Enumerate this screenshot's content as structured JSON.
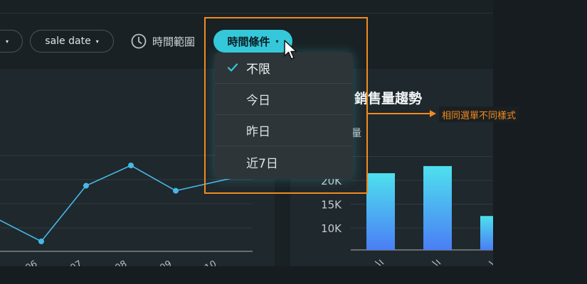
{
  "filters": {
    "partial_chip_caret": "▾",
    "sale_date_label": "sale date",
    "sale_date_caret": "▾",
    "time_range_label": "時間範圍",
    "time_condition_label": "時間條件",
    "time_condition_caret": "▾"
  },
  "dropdown": {
    "items": [
      {
        "label": "不限",
        "selected": true
      },
      {
        "label": "今日",
        "selected": false
      },
      {
        "label": "昨日",
        "selected": false
      },
      {
        "label": "近7日",
        "selected": false
      }
    ]
  },
  "annotation": {
    "label": "相同選單不同樣式",
    "color": "#f28a1e"
  },
  "colors": {
    "accent": "#35c8da",
    "line_series": "#46b8e8",
    "bar_top": "#4ee0ee",
    "bar_bottom": "#4a7ef5"
  },
  "icons": {
    "clock": "clock-icon",
    "check": "check-icon",
    "cursor": "mouse-pointer-icon"
  },
  "chart_data": [
    {
      "type": "line",
      "categories": [
        "06",
        "07",
        "08",
        "09",
        "10"
      ],
      "values": [
        null,
        1.0,
        3.2,
        4.0,
        3.0
      ],
      "tick_labels": [
        "06",
        "07",
        "08",
        "09",
        "10"
      ],
      "title": "",
      "grid": true
    },
    {
      "type": "bar",
      "title": "銷售量趨勢",
      "ylabel": "量",
      "y_ticks": [
        "10K",
        "15K",
        "20K"
      ],
      "categories": [
        "",
        "",
        ""
      ],
      "values": [
        21500,
        23000,
        12500
      ],
      "ylim": [
        7500,
        27500
      ],
      "grid": true
    }
  ]
}
